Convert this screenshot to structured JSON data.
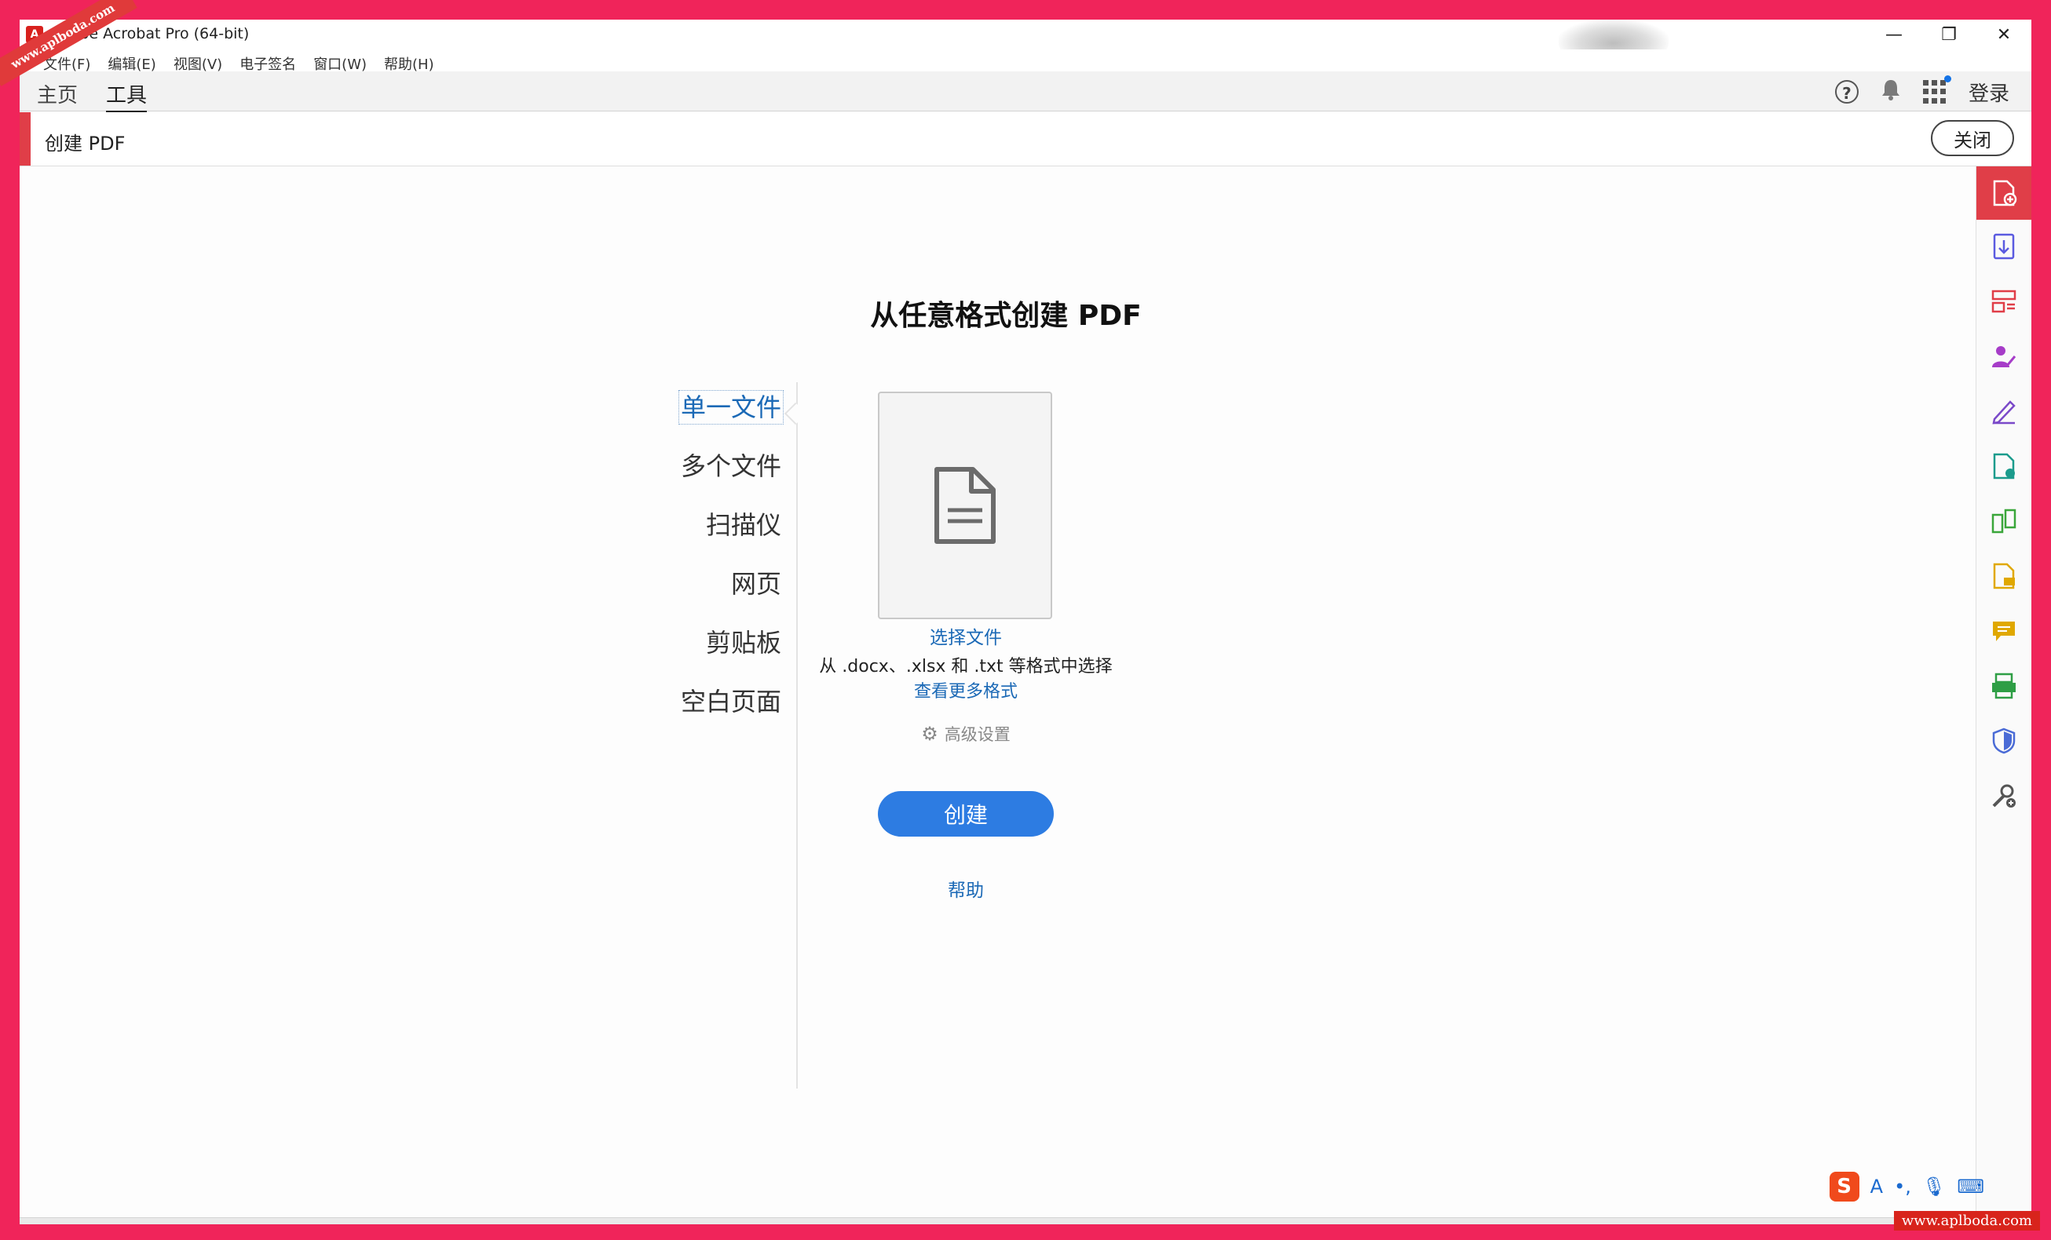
{
  "window": {
    "title": "Adobe Acrobat Pro (64-bit)",
    "minimize": "—",
    "restore": "❐",
    "close": "✕"
  },
  "menu": [
    "文件(F)",
    "编辑(E)",
    "视图(V)",
    "电子签名",
    "窗口(W)",
    "帮助(H)"
  ],
  "nav": {
    "tabs": [
      "主页",
      "工具"
    ],
    "active_tab": "工具",
    "login": "登录",
    "help_glyph": "?"
  },
  "tool": {
    "title": "创建 PDF",
    "close_label": "关闭"
  },
  "main": {
    "title": "从任意格式创建 PDF",
    "sources": [
      "单一文件",
      "多个文件",
      "扫描仪",
      "网页",
      "剪贴板",
      "空白页面"
    ],
    "active_source": "单一文件",
    "choose_file": "选择文件",
    "formats_text": "从 .docx、.xlsx 和 .txt 等格式中选择",
    "more_formats": "查看更多格式",
    "advanced_settings": "高级设置",
    "create_label": "创建",
    "help_label": "帮助"
  },
  "right_rail": [
    {
      "icon": "create-pdf-icon",
      "color": "#ffffff"
    },
    {
      "icon": "export-pdf-icon",
      "color": "#5b5be0"
    },
    {
      "icon": "organize-pages-icon",
      "color": "#e03e48"
    },
    {
      "icon": "request-signatures-icon",
      "color": "#a63cc8"
    },
    {
      "icon": "fill-sign-icon",
      "color": "#7a49c9"
    },
    {
      "icon": "edit-pdf-icon",
      "color": "#1b9b8c"
    },
    {
      "icon": "combine-files-icon",
      "color": "#3aa63a"
    },
    {
      "icon": "export-pdf-yellow-icon",
      "color": "#e0a800"
    },
    {
      "icon": "comment-icon",
      "color": "#e0a800"
    },
    {
      "icon": "scan-ocr-icon",
      "color": "#2e9e45"
    },
    {
      "icon": "protect-icon",
      "color": "#4a6bd6"
    },
    {
      "icon": "more-tools-icon",
      "color": "#555555"
    }
  ],
  "ime": {
    "logo": "S",
    "mode": "A"
  },
  "watermark": "www.aplboda.com",
  "colors": {
    "accent_red": "#e03e48",
    "link_blue": "#1b69b6",
    "primary_button": "#2d7ce2",
    "frame": "#f0245a"
  }
}
